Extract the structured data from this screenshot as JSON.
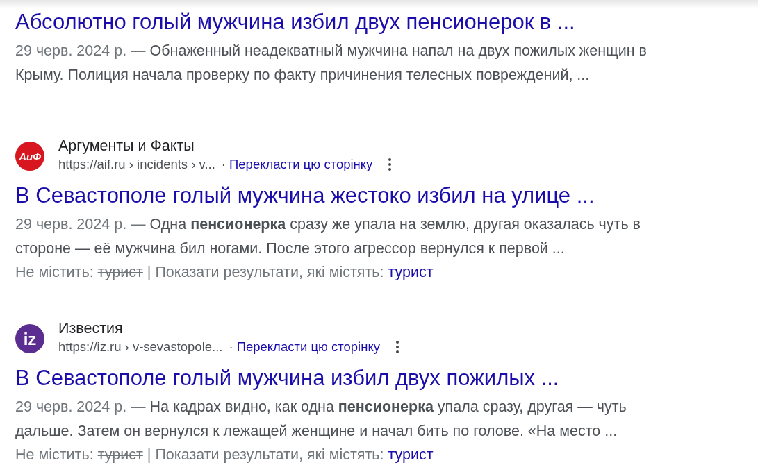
{
  "results": [
    {
      "title": "Абсолютно голый мужчина избил двух пенсионерок в ...",
      "date": "29 черв. 2024 р. —",
      "snippet": "Обнаженный неадекватный мужчина напал на двух пожилых женщин в Крыму. Полиция начала проверку по факту причинения телесных повреждений, ..."
    },
    {
      "source": {
        "name": "Аргументы и Факты",
        "logo_text": "АиФ",
        "color": "#d7161f",
        "url": "https://aif.ru › incidents › v...",
        "separator": "·",
        "translate": "Перекласти цю сторінку"
      },
      "title": "В Севастополе голый мужчина жестоко избил на улице ...",
      "date": "29 черв. 2024 р. —",
      "snippet": "Одна **пенсионерка** сразу же упала на землю, другая оказалась чуть в стороне — её мужчина бил ногами. После этого агрессор вернулся к первой ...",
      "missing": {
        "label": "Не містить:",
        "term": "турист",
        "separator": "|",
        "prompt": "Показати результати, які містять:",
        "link": "турист"
      }
    },
    {
      "source": {
        "name": "Известия",
        "logo_text": "iz",
        "color": "#5b2d90",
        "url": "https://iz.ru › v-sevastopole...",
        "separator": "·",
        "translate": "Перекласти цю сторінку"
      },
      "title": "В Севастополе голый мужчина избил двух пожилых ...",
      "date": "29 черв. 2024 р. —",
      "snippet": "На кадрах видно, как одна **пенсионерка** упала сразу, другая — чуть дальше. Затем он вернулся к лежащей женщине и начал бить по голове. «На место ...",
      "missing": {
        "label": "Не містить:",
        "term": "турист",
        "separator": "|",
        "prompt": "Показати результати, які містять:",
        "link": "турист"
      }
    }
  ]
}
